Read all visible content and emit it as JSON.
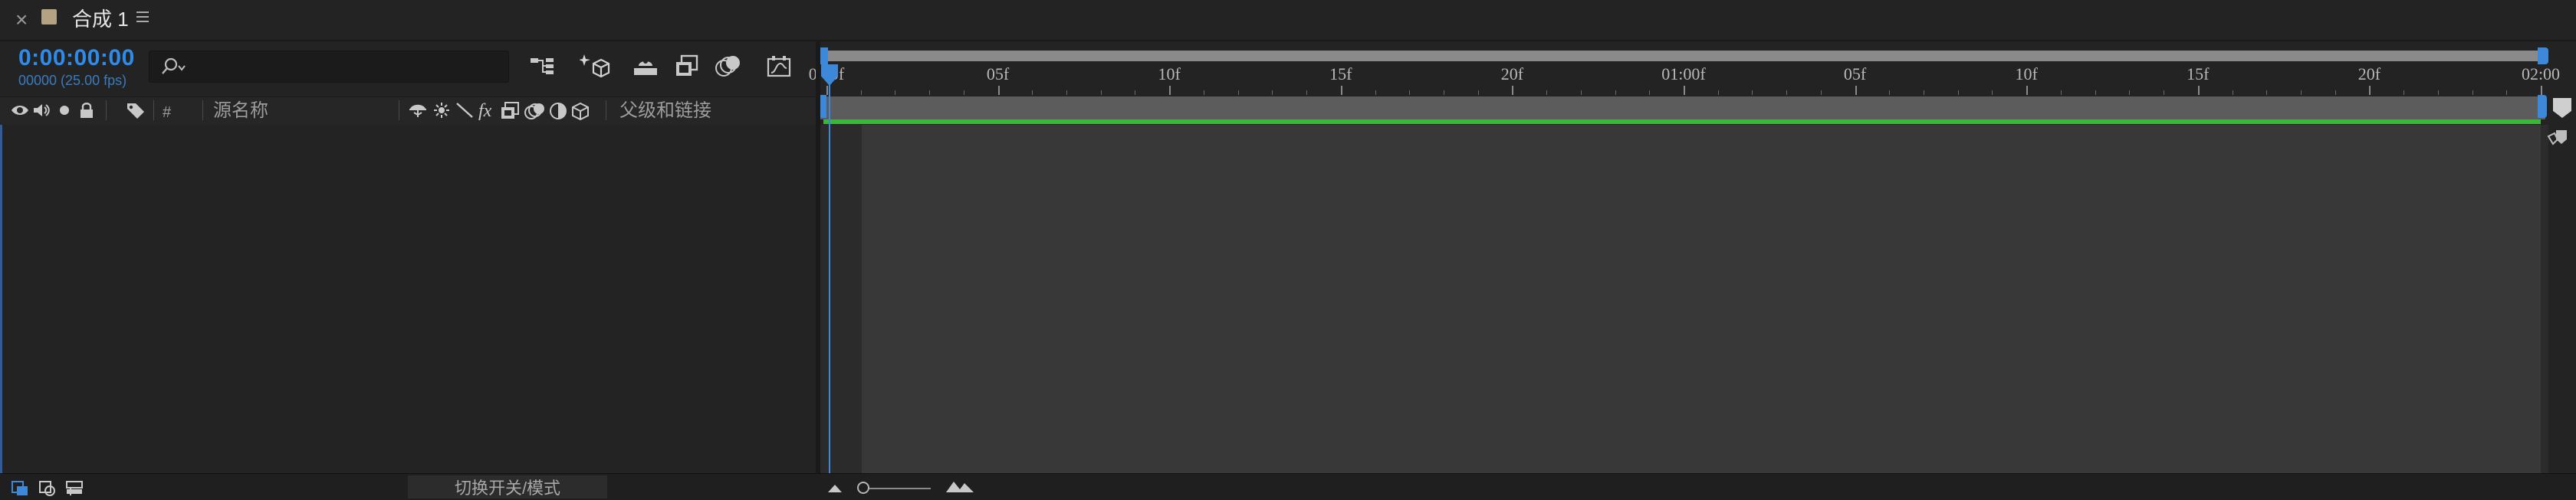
{
  "tab": {
    "close_glyph": "×",
    "title": "合成 1",
    "swatch_color": "#b5a284",
    "menu_icon": "hamburger-icon"
  },
  "timecode": {
    "value": "0:00:00:00",
    "frames_info": "00000 (25.00 fps)"
  },
  "search": {
    "value": "",
    "placeholder": ""
  },
  "tools": [
    "composition-mini-flowchart-icon",
    "draft-3d-icon",
    "hide-shy-layers-icon",
    "frame-blending-icon",
    "motion-blur-icon",
    "graph-editor-icon"
  ],
  "ruler": {
    "ticks": [
      "0:00f",
      "05f",
      "10f",
      "15f",
      "20f",
      "01:00f",
      "05f",
      "10f",
      "15f",
      "20f",
      "02:00"
    ]
  },
  "layer_header": {
    "switch_icons": [
      "video-eye-icon",
      "audio-speaker-icon",
      "solo-dot-icon",
      "lock-icon",
      "label-tag-icon"
    ],
    "number_label": "#",
    "source_name_label": "源名称",
    "layer_switch_icons": [
      "shy-icon",
      "collapse-icon",
      "quality-icon",
      "effect-fx-icon",
      "frame-blend-icon",
      "motion-blur-icon",
      "adjustment-icon",
      "3d-cube-icon"
    ],
    "fx_label": "fx",
    "parent_label": "父级和链接"
  },
  "timeline": {
    "playhead_color": "#3d88d8",
    "work_area_color": "#3bb53b"
  },
  "footer": {
    "toggle_label": "切换开关/模式",
    "icons": [
      "layer-switches-pane-icon",
      "transfer-controls-pane-icon",
      "in-out-pane-icon"
    ]
  }
}
